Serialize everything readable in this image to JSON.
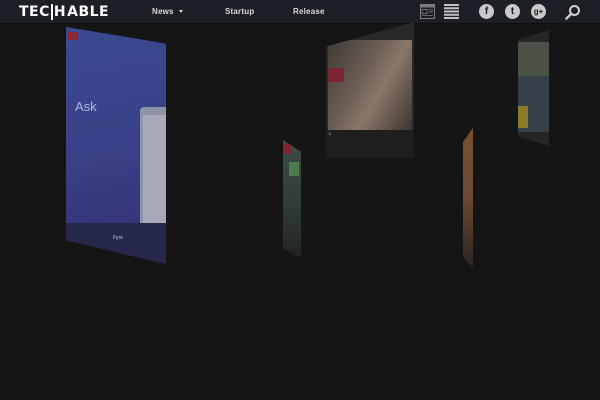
{
  "header": {
    "logo_prefix": "TEC",
    "logo_highlight": "H",
    "logo_suffix": "ABLE",
    "nav": [
      {
        "label": "News",
        "has_dropdown": true
      },
      {
        "label": "Startup"
      },
      {
        "label": "Release"
      }
    ],
    "view_icons": [
      "grid-view-icon",
      "list-view-icon"
    ],
    "social_icons": [
      {
        "name": "facebook-icon",
        "glyph": "f"
      },
      {
        "name": "twitter-icon",
        "glyph": "t"
      },
      {
        "name": "google-plus-icon",
        "glyph": "g+"
      }
    ],
    "search_icon": "search-icon"
  },
  "cards": {
    "main": {
      "heading": "Ask",
      "footer": "Fyre"
    },
    "photo": {
      "close_glyph": "×"
    }
  },
  "colors": {
    "background": "#151515",
    "header_bg": "#1c2026",
    "header_text": "#d9d9d9",
    "card_accent_red": "#7b2632",
    "card_blue": "#3b4a8f"
  }
}
